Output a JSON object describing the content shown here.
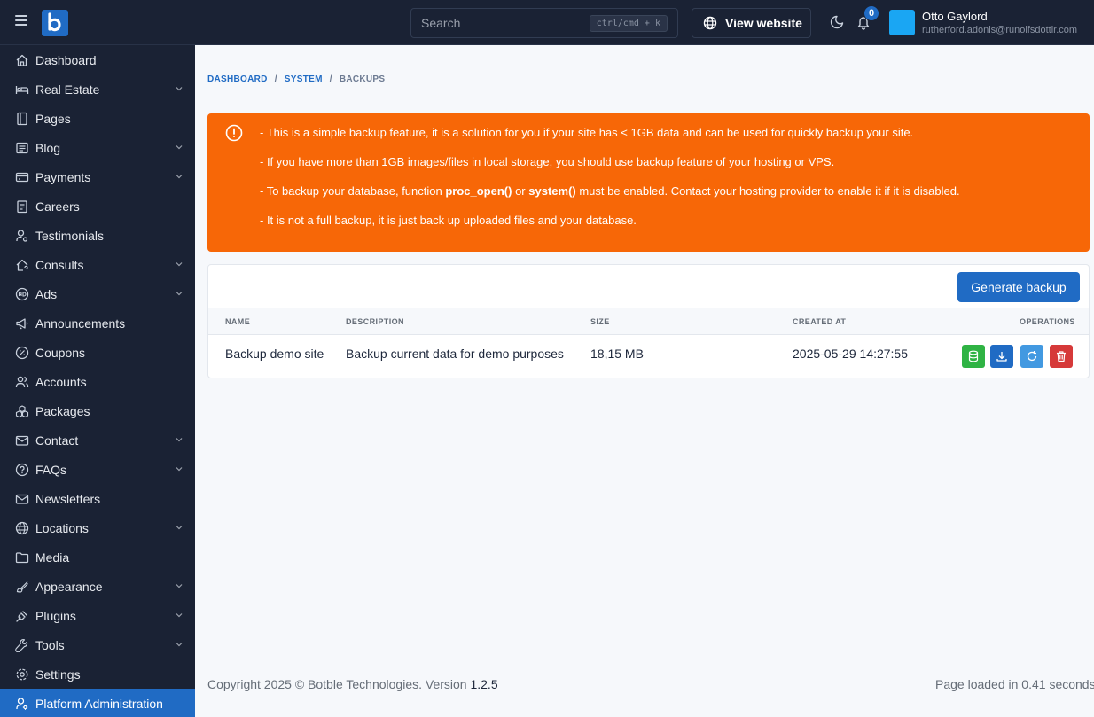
{
  "topbar": {
    "search_placeholder": "Search",
    "search_shortcut": "ctrl/cmd + k",
    "view_website": "View website",
    "notification_count": "0",
    "user_name": "Otto Gaylord",
    "user_email": "rutherford.adonis@runolfsdottir.com"
  },
  "sidebar": {
    "items": [
      {
        "label": "Dashboard",
        "icon": "home-icon"
      },
      {
        "label": "Real Estate",
        "icon": "bed-icon"
      },
      {
        "label": "Pages",
        "icon": "page-icon"
      },
      {
        "label": "Blog",
        "icon": "article-icon"
      },
      {
        "label": "Payments",
        "icon": "credit-card-icon"
      },
      {
        "label": "Careers",
        "icon": "clipboard-icon"
      },
      {
        "label": "Testimonials",
        "icon": "user-quote-icon"
      },
      {
        "label": "Consults",
        "icon": "home-question-icon"
      },
      {
        "label": "Ads",
        "icon": "ad-circle-icon"
      },
      {
        "label": "Announcements",
        "icon": "speakerphone-icon"
      },
      {
        "label": "Coupons",
        "icon": "discount-icon"
      },
      {
        "label": "Accounts",
        "icon": "users-icon"
      },
      {
        "label": "Packages",
        "icon": "packages-icon"
      },
      {
        "label": "Contact",
        "icon": "mail-icon"
      },
      {
        "label": "FAQs",
        "icon": "help-circle-icon"
      },
      {
        "label": "Newsletters",
        "icon": "mail-icon"
      },
      {
        "label": "Locations",
        "icon": "world-icon"
      },
      {
        "label": "Media",
        "icon": "folder-icon"
      },
      {
        "label": "Appearance",
        "icon": "brush-icon"
      },
      {
        "label": "Plugins",
        "icon": "plug-icon"
      },
      {
        "label": "Tools",
        "icon": "tool-icon"
      },
      {
        "label": "Settings",
        "icon": "gear-icon"
      },
      {
        "label": "Platform Administration",
        "icon": "user-cog-icon"
      }
    ]
  },
  "breadcrumb": {
    "dashboard": "DASHBOARD",
    "system": "SYSTEM",
    "current": "BACKUPS",
    "separator": "/"
  },
  "alert": {
    "line1": "- This is a simple backup feature, it is a solution for you if your site has < 1GB data and can be used for quickly backup your site.",
    "line2": "- If you have more than 1GB images/files in local storage, you should use backup feature of your hosting or VPS.",
    "line3_pre": "- To backup your database, function ",
    "line3_fn1": "proc_open()",
    "line3_or": " or ",
    "line3_fn2": "system()",
    "line3_post": " must be enabled. Contact your hosting provider to enable it if it is disabled.",
    "line4": "- It is not a full backup, it is just back up uploaded files and your database."
  },
  "backups": {
    "generate_label": "Generate backup",
    "columns": {
      "name": "NAME",
      "description": "DESCRIPTION",
      "size": "SIZE",
      "created_at": "CREATED AT",
      "operations": "OPERATIONS"
    },
    "rows": [
      {
        "name": "Backup demo site",
        "description": "Backup current data for demo purposes",
        "size": "18,15 MB",
        "created_at": "2025-05-29 14:27:55"
      }
    ]
  },
  "colors": {
    "primary": "#206bc4",
    "sidebar_bg": "#1a2234",
    "alert_orange": "#f76707",
    "op_restore_green": "#2fb344",
    "op_download_blue": "#206bc4",
    "op_refresh_azure": "#4299e1",
    "op_delete_red": "#d63939"
  },
  "footer": {
    "copyright_prefix": "Copyright 2025 © Botble Technologies. Version ",
    "version": "1.2.5",
    "page_loaded": "Page loaded in 0.41 seconds"
  }
}
